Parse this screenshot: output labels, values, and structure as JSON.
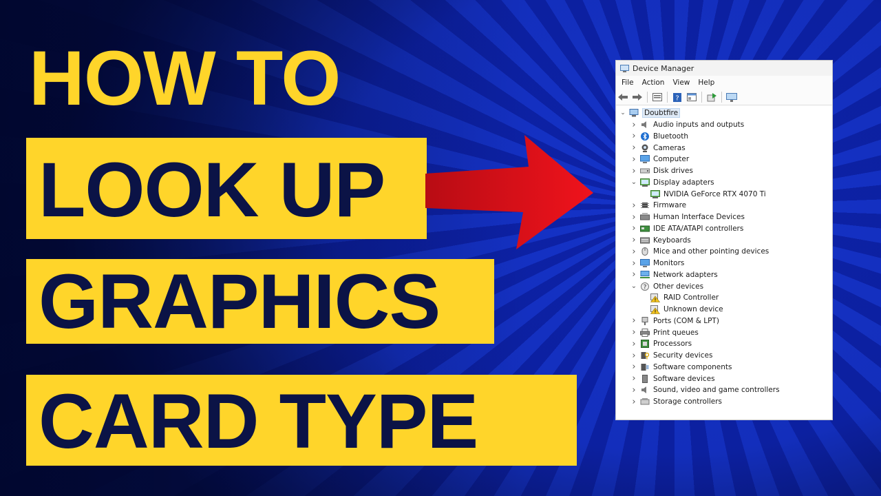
{
  "headline": {
    "line1": "HOW TO",
    "line2": "LOOK UP",
    "line3": "GRAPHICS",
    "line4": "CARD TYPE"
  },
  "colors": {
    "accent_yellow": "#ffd52a",
    "headline_text": "#0b1346",
    "arrow_red": "#e3111a",
    "background_blue": "#1533c9"
  },
  "device_manager": {
    "title": "Device Manager",
    "menu": [
      "File",
      "Action",
      "View",
      "Help"
    ],
    "toolbar": [
      "back-icon",
      "forward-icon",
      "properties-icon",
      "help-icon",
      "details-icon",
      "update-driver-icon",
      "scan-hardware-icon"
    ],
    "root": "Doubtfire",
    "items": [
      {
        "label": "Audio inputs and outputs",
        "icon": "speaker-icon",
        "expanded": false
      },
      {
        "label": "Bluetooth",
        "icon": "bluetooth-icon",
        "expanded": false
      },
      {
        "label": "Cameras",
        "icon": "camera-icon",
        "expanded": false
      },
      {
        "label": "Computer",
        "icon": "computer-icon",
        "expanded": false
      },
      {
        "label": "Disk drives",
        "icon": "disk-icon",
        "expanded": false
      },
      {
        "label": "Display adapters",
        "icon": "display-adapter-icon",
        "expanded": true,
        "children": [
          {
            "label": "NVIDIA GeForce RTX 4070 Ti",
            "icon": "display-adapter-icon"
          }
        ]
      },
      {
        "label": "Firmware",
        "icon": "chip-icon",
        "expanded": false
      },
      {
        "label": "Human Interface Devices",
        "icon": "hid-icon",
        "expanded": false
      },
      {
        "label": "IDE ATA/ATAPI controllers",
        "icon": "controller-icon",
        "expanded": false
      },
      {
        "label": "Keyboards",
        "icon": "keyboard-icon",
        "expanded": false
      },
      {
        "label": "Mice and other pointing devices",
        "icon": "mouse-icon",
        "expanded": false
      },
      {
        "label": "Monitors",
        "icon": "monitor-icon",
        "expanded": false
      },
      {
        "label": "Network adapters",
        "icon": "network-icon",
        "expanded": false
      },
      {
        "label": "Other devices",
        "icon": "unknown-device-icon",
        "expanded": true,
        "children": [
          {
            "label": "RAID Controller",
            "icon": "warning-device-icon"
          },
          {
            "label": "Unknown device",
            "icon": "warning-device-icon"
          }
        ]
      },
      {
        "label": "Ports (COM & LPT)",
        "icon": "port-icon",
        "expanded": false
      },
      {
        "label": "Print queues",
        "icon": "printer-icon",
        "expanded": false
      },
      {
        "label": "Processors",
        "icon": "processor-icon",
        "expanded": false
      },
      {
        "label": "Security devices",
        "icon": "security-icon",
        "expanded": false
      },
      {
        "label": "Software components",
        "icon": "software-component-icon",
        "expanded": false
      },
      {
        "label": "Software devices",
        "icon": "software-device-icon",
        "expanded": false
      },
      {
        "label": "Sound, video and game controllers",
        "icon": "speaker-icon",
        "expanded": false
      },
      {
        "label": "Storage controllers",
        "icon": "storage-icon",
        "expanded": false
      }
    ]
  }
}
